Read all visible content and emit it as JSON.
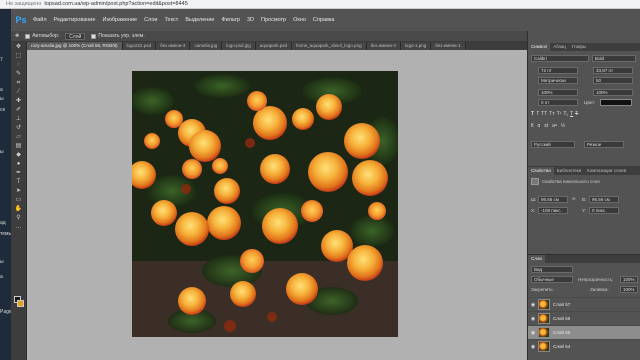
{
  "browser": {
    "security": "Не защищено",
    "url": "topsad.com.ua/wp-admin/post.php?action=edit&post=8445"
  },
  "left_strip": {
    "items": [
      "7",
      "а",
      "ы",
      "се",
      "ы",
      "ад",
      "темы",
      "ы",
      "а",
      "Page"
    ]
  },
  "menubar": {
    "logo": "Ps",
    "items": [
      "Файл",
      "Редактирование",
      "Изображение",
      "Слои",
      "Текст",
      "Выделение",
      "Фильтр",
      "3D",
      "Просмотр",
      "Окно",
      "Справка"
    ]
  },
  "options": {
    "autoselect_label": "Автовыбор:",
    "autoselect_value": "Слой",
    "show_controls_label": "Показать упр. элем."
  },
  "tabs": [
    {
      "label": "rozy-amalia.jpg @ 100% (Слой 55, RGB/8)",
      "active": true
    },
    {
      "label": "logo222.psd",
      "active": false
    },
    {
      "label": "без имени-3",
      "active": false
    },
    {
      "label": "camelia.jpg",
      "active": false
    },
    {
      "label": "logo-psd.jpg",
      "active": false
    },
    {
      "label": "aquapark.psd",
      "active": false
    },
    {
      "label": "home_aquapark_obsol_logo.png",
      "active": false
    },
    {
      "label": "без имени-4",
      "active": false
    },
    {
      "label": "logo-1.png",
      "active": false
    },
    {
      "label": "без имени-1",
      "active": false
    }
  ],
  "tools": [
    "move",
    "marquee",
    "lasso",
    "quick-select",
    "crop",
    "eyedropper",
    "healing",
    "brush",
    "stamp",
    "history-brush",
    "eraser",
    "gradient",
    "blur",
    "dodge",
    "pen",
    "type",
    "path-select",
    "shape",
    "hand",
    "zoom",
    "more"
  ],
  "character_panel": {
    "tabs": [
      "Символ",
      "Абзац",
      "Глифы"
    ],
    "font_family": "Calibri",
    "font_style": "Bold",
    "font_size": "72 пт",
    "leading": "33,87 пт",
    "kerning": "Метрически",
    "tracking": "50",
    "vscale": "100%",
    "hscale": "100%",
    "baseline": "0 пт",
    "color_label": "Цвет:",
    "color_value": "#111111",
    "language": "Русский",
    "antialias": "Резкое"
  },
  "properties_panel": {
    "tabs": [
      "Свойства",
      "Библиотеки",
      "Композиции слоев"
    ],
    "title": "Свойства пиксельного слоя",
    "w_label": "Ш:",
    "w_value": "96,56 см",
    "h_label": "В:",
    "h_value": "96,56 см",
    "x_label": "X:",
    "x_value": "-108 пикс.",
    "y_label": "Y:",
    "y_value": "0 пикс."
  },
  "layers_panel": {
    "tab": "Слои",
    "filter_label": "Вид",
    "blend_mode": "Обычные",
    "opacity_label": "Непрозрачность:",
    "opacity_value": "100%",
    "lock_label": "Закрепить:",
    "fill_label": "Заливка:",
    "fill_value": "100%",
    "layers": [
      {
        "name": "Слой 57",
        "selected": false
      },
      {
        "name": "Слой 56",
        "selected": false
      },
      {
        "name": "Слой 55",
        "selected": true
      },
      {
        "name": "Слой 54",
        "selected": false
      }
    ]
  },
  "colors": {
    "menubar": "#535353",
    "panel": "#535353",
    "canvas_bg": "#b1b1b1",
    "accent": "#31a8ff"
  }
}
